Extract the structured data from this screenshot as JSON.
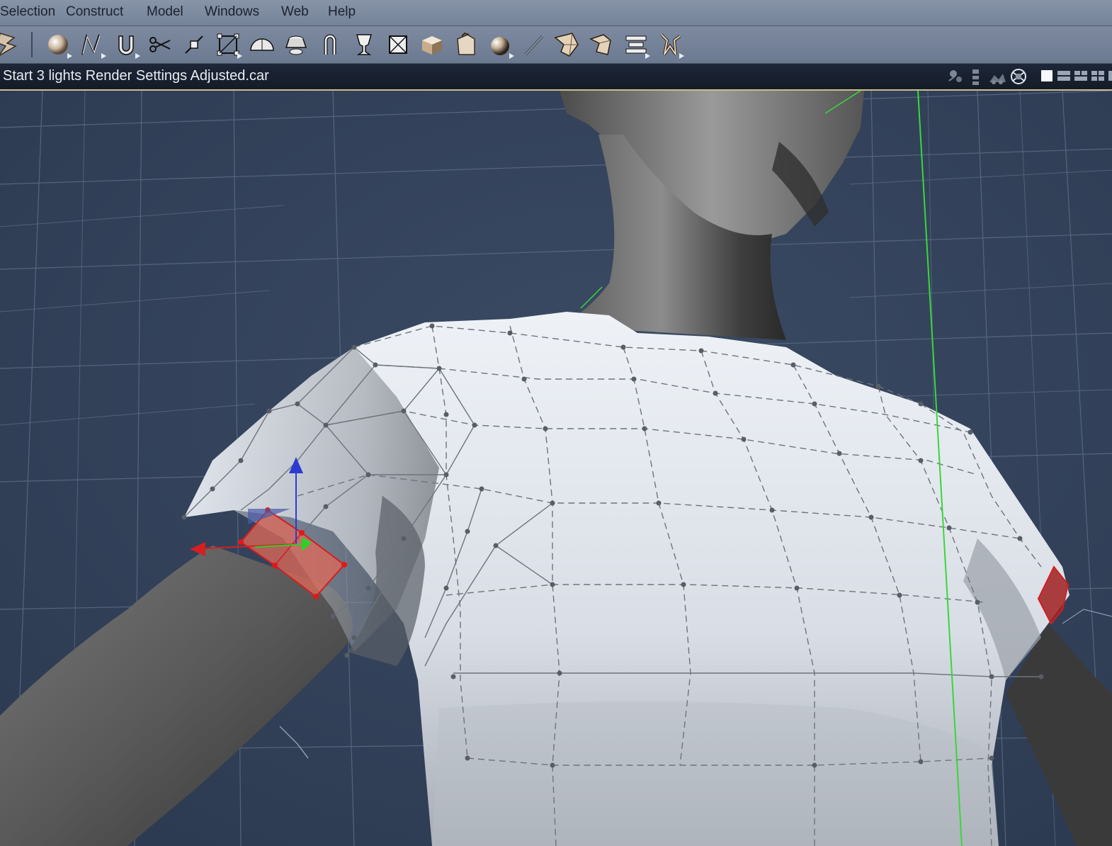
{
  "menubar": {
    "items": [
      "Selection",
      "Construct",
      "Model",
      "Windows",
      "Web",
      "Help"
    ]
  },
  "toolbar": {
    "tools": [
      "lightning-tool-icon",
      "sphere-tool-icon",
      "spline-tool-icon",
      "magnet-tool-icon",
      "scissors-tool-icon",
      "vertex-move-tool-icon",
      "bounding-box-tool-icon",
      "dome-tool-icon",
      "lathe-tool-icon",
      "bend-tool-icon",
      "goblet-tool-icon",
      "crossed-box-tool-icon",
      "box-tool-icon",
      "bag-tool-icon",
      "shaded-sphere-tool-icon",
      "pen-tool-icon",
      "deform-tool-icon",
      "twist-tool-icon",
      "stack-tool-icon",
      "figure-tool-icon"
    ]
  },
  "document": {
    "title": "Start 3 lights Render Settings Adjusted.car"
  },
  "viewport": {
    "background": "#33435a",
    "grid_color": "#5d6c85",
    "shirt_color": "#dfe4ec",
    "skin_color": "#6b6b6b",
    "selection_color": "#e04a3a",
    "axis_y_color": "#2d3bd1",
    "axis_x_color": "#d42020",
    "axis_z_color": "#2bd12b"
  }
}
